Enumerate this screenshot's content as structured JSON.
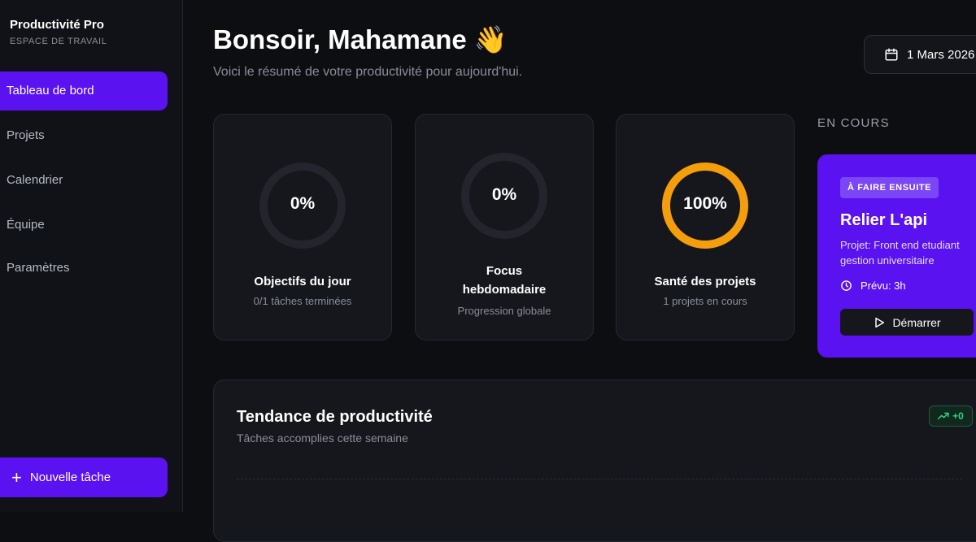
{
  "sidebar": {
    "brand_title": "Productivité Pro",
    "brand_subtitle": "ESPACE DE TRAVAIL",
    "items": [
      {
        "label": "Tableau de bord",
        "active": true
      },
      {
        "label": "Projets"
      },
      {
        "label": "Calendrier"
      },
      {
        "label": "Équipe"
      },
      {
        "label": "Paramètres"
      }
    ],
    "new_task_label": "Nouvelle tâche",
    "accent_color": "#5a12f0"
  },
  "header": {
    "greeting": "Bonsoir, Mahamane 👋",
    "subtitle": "Voici le résumé de votre productivité pour aujourd'hui.",
    "date": "1 Mars 2026"
  },
  "stats": [
    {
      "value_label": "0%",
      "progress": 0,
      "title": "Objectifs du jour",
      "subtitle": "0/1 tâches terminées",
      "color": "#2a2b33"
    },
    {
      "value_label": "0%",
      "progress": 0,
      "title": "Focus hebdomadaire",
      "subtitle": "Progression globale",
      "color": "#2a2b33"
    },
    {
      "value_label": "100%",
      "progress": 1,
      "title": "Santé des projets",
      "subtitle": "1 projets en cours",
      "color": "#f59e0b"
    }
  ],
  "in_progress": {
    "section_label": "EN COURS",
    "badge": "À FAIRE ENSUITE",
    "task_title": "Relier L'api",
    "project": "Projet: Front end etudiant gestion universitaire",
    "estimate": "Prévu: 3h",
    "start_label": "Démarrer"
  },
  "trend": {
    "title": "Tendance de productivité",
    "subtitle": "Tâches accomplies cette semaine",
    "badge": "+0",
    "badge_color": "#2fd47e"
  }
}
